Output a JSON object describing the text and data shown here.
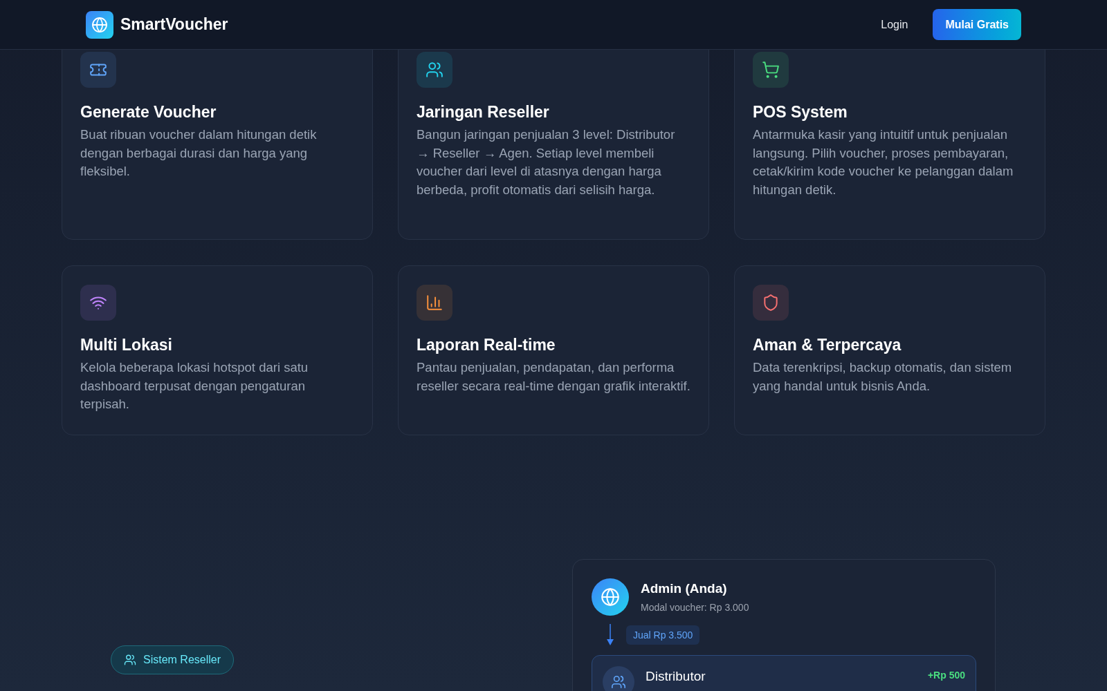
{
  "header": {
    "brand": "SmartVoucher",
    "login": "Login",
    "cta": "Mulai Gratis"
  },
  "features": [
    {
      "kind": "ticket",
      "color": "#60a5fa",
      "title": "Generate Voucher",
      "text": "Buat ribuan voucher dalam hitungan detik dengan berbagai durasi dan harga yang fleksibel."
    },
    {
      "kind": "users",
      "color": "#22d3ee",
      "title": "Jaringan Reseller",
      "text": "Bangun jaringan penjualan 3 level: Distributor → Reseller → Agen. Setiap level membeli voucher dari level di atasnya dengan harga berbeda, profit otomatis dari selisih harga."
    },
    {
      "kind": "cart",
      "color": "#4ade80",
      "title": "POS System",
      "text": "Antarmuka kasir yang intuitif untuk penjualan langsung. Pilih voucher, proses pembayaran, cetak/kirim kode voucher ke pelanggan dalam hitungan detik."
    },
    {
      "kind": "wifi",
      "color": "#c084fc",
      "title": "Multi Lokasi",
      "text": "Kelola beberapa lokasi hotspot dari satu dashboard terpusat dengan pengaturan terpisah."
    },
    {
      "kind": "chart",
      "color": "#fb923c",
      "title": "Laporan Real-time",
      "text": "Pantau penjualan, pendapatan, dan performa reseller secara real-time dengan grafik interaktif."
    },
    {
      "kind": "shield",
      "color": "#f87171",
      "title": "Aman & Terpercaya",
      "text": "Data terenkripsi, backup otomatis, dan sistem yang handal untuk bisnis Anda."
    }
  ],
  "reseller": {
    "badge": "Sistem Reseller",
    "admin": {
      "name": "Admin (Anda)",
      "cost": "Modal voucher: Rp 3.000",
      "sell": "Jual Rp 3.500"
    },
    "levels": [
      {
        "name": "Distributor",
        "profit": "+Rp 500"
      }
    ]
  }
}
